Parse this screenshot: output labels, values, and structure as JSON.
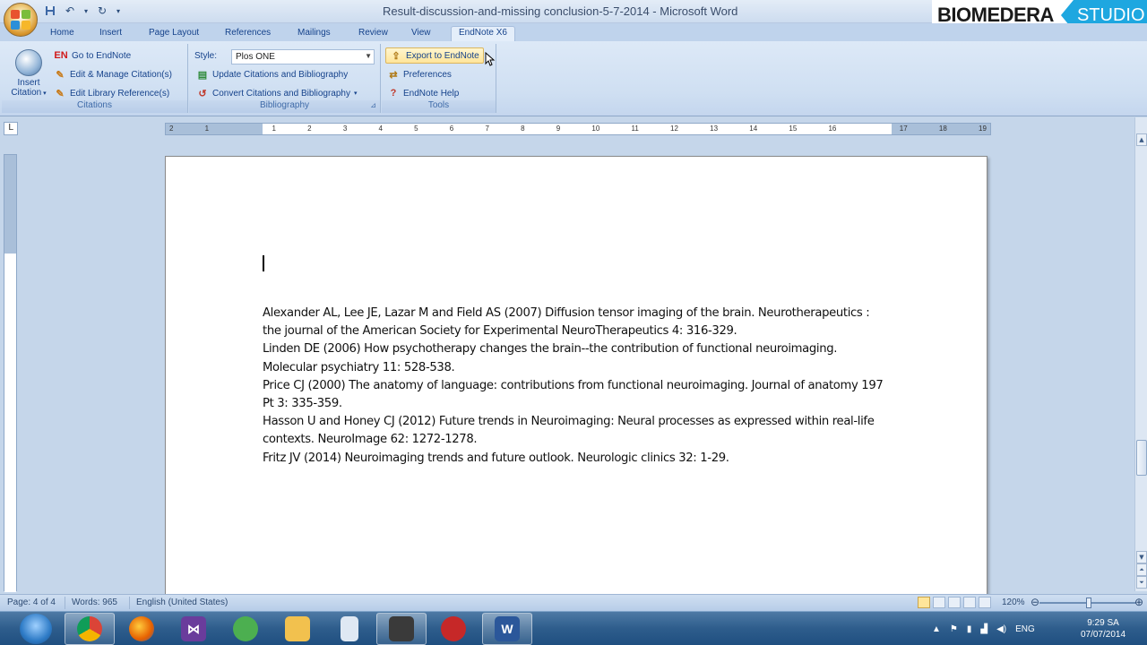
{
  "window": {
    "title": "Result-discussion-and-missing conclusion-5-7-2014 - Microsoft Word"
  },
  "brand": {
    "part1": "BIOMEDERA",
    "part2": "STUDIO"
  },
  "tabs": [
    "Home",
    "Insert",
    "Page Layout",
    "References",
    "Mailings",
    "Review",
    "View",
    "EndNote X6"
  ],
  "ribbon": {
    "citations": {
      "insert_citation": "Insert Citation",
      "go_to_endnote": "Go to EndNote",
      "edit_manage": "Edit & Manage Citation(s)",
      "edit_library": "Edit Library Reference(s)",
      "group_label": "Citations",
      "en_badge": "EN"
    },
    "bibliography": {
      "style_label": "Style:",
      "style_value": "Plos ONE",
      "update": "Update Citations and Bibliography",
      "convert": "Convert Citations and Bibliography",
      "group_label": "Bibliography"
    },
    "tools": {
      "export": "Export to EndNote",
      "preferences": "Preferences",
      "help": "EndNote Help",
      "group_label": "Tools"
    }
  },
  "document": {
    "references": [
      "Alexander AL, Lee JE, Lazar M and Field AS (2007) Diffusion tensor imaging of the brain. Neurotherapeutics : the journal of the American Society for Experimental NeuroTherapeutics 4: 316-329.",
      "Linden DE (2006) How psychotherapy changes the brain--the contribution of functional neuroimaging. Molecular psychiatry 11: 528-538.",
      "Price CJ (2000) The anatomy of language: contributions from functional neuroimaging. Journal of anatomy 197 Pt 3: 335-359.",
      "Hasson U and Honey CJ (2012) Future trends in  Neuroimaging: Neural processes as expressed within real-life contexts. NeuroImage 62: 1272-1278.",
      "Fritz JV (2014) Neuroimaging trends and future outlook. Neurologic clinics 32: 1-29."
    ]
  },
  "ruler": {
    "numbers": [
      "2",
      "1",
      "",
      "1",
      "2",
      "3",
      "4",
      "5",
      "6",
      "7",
      "8",
      "9",
      "10",
      "11",
      "12",
      "13",
      "14",
      "15",
      "16",
      "",
      "17",
      "18",
      "19"
    ]
  },
  "status": {
    "page": "Page: 4 of 4",
    "words": "Words: 965",
    "language": "English (United States)",
    "zoom": "120%"
  },
  "tray": {
    "lang": "ENG",
    "time": "9:29 SA",
    "date": "07/07/2014"
  },
  "colors": {
    "accent_brand": "#1ea7e0",
    "ribbon": "#dde9f7",
    "taskbar": "#2e5d8c"
  }
}
